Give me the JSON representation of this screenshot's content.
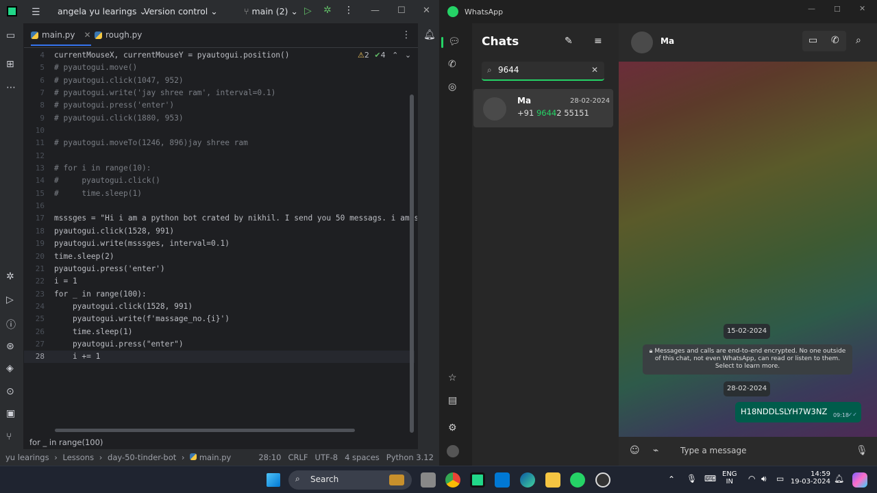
{
  "ide": {
    "project": "angela yu learings",
    "vcs": "Version control",
    "branch": "main (2)",
    "tabs": [
      {
        "label": "main.py"
      },
      {
        "label": "rough.py"
      }
    ],
    "inspections": {
      "warnings": "2",
      "ok": "4"
    },
    "lines": [
      {
        "num": "4",
        "text": "currentMouseX, currentMouseY = pyautogui.position()"
      },
      {
        "num": "5",
        "text": "# pyautogui.move()"
      },
      {
        "num": "6",
        "text": "# pyautogui.click(1047, 952)"
      },
      {
        "num": "7",
        "text": "# pyautogui.write('jay shree ram', interval=0.1)"
      },
      {
        "num": "8",
        "text": "# pyautogui.press('enter')"
      },
      {
        "num": "9",
        "text": "# pyautogui.click(1880, 953)"
      },
      {
        "num": "10",
        "text": ""
      },
      {
        "num": "11",
        "text": "# pyautogui.moveTo(1246, 896)jay shree ram"
      },
      {
        "num": "12",
        "text": ""
      },
      {
        "num": "13",
        "text": "# for i in range(10):"
      },
      {
        "num": "14",
        "text": "#     pyautogui.click()"
      },
      {
        "num": "15",
        "text": "#     time.sleep(1)"
      },
      {
        "num": "16",
        "text": ""
      },
      {
        "num": "17",
        "text": "msssges = \"Hi i am a python bot crated by nikhil. I send you 50 messags. i am s"
      },
      {
        "num": "18",
        "text": "pyautogui.click(1528, 991)"
      },
      {
        "num": "19",
        "text": "pyautogui.write(msssges, interval=0.1)"
      },
      {
        "num": "20",
        "text": "time.sleep(2)"
      },
      {
        "num": "21",
        "text": "pyautogui.press('enter')"
      },
      {
        "num": "22",
        "text": "i = 1"
      },
      {
        "num": "23",
        "text": "for _ in range(100):"
      },
      {
        "num": "24",
        "text": "    pyautogui.click(1528, 991)"
      },
      {
        "num": "25",
        "text": "    pyautogui.write(f'massage_no.{i}')"
      },
      {
        "num": "26",
        "text": "    time.sleep(1)"
      },
      {
        "num": "27",
        "text": "    pyautogui.press(\"enter\")"
      },
      {
        "num": "28",
        "text": "    i += 1"
      }
    ],
    "breadcrumb": "for _ in range(100)",
    "status": {
      "path": [
        "yu learings",
        "Lessons",
        "day-50-tinder-bot",
        "main.py"
      ],
      "position": "28:10",
      "line_sep": "CRLF",
      "encoding": "UTF-8",
      "indent": "4 spaces",
      "interpreter": "Python 3.12"
    }
  },
  "whatsapp": {
    "app_title": "WhatsApp",
    "chats_title": "Chats",
    "search_value": "9644",
    "chat": {
      "name": "Ma",
      "date": "28-02-2024",
      "phone_pre": "+91 ",
      "phone_match": "9644",
      "phone_post": "2 55151"
    },
    "header_name": "Ma",
    "date_pill_1": "15-02-2024",
    "encryption_notice": "Messages and calls are end-to-end encrypted. No one outside of this chat, not even WhatsApp, can read or listen to them. Select to learn more.",
    "date_pill_2": "28-02-2024",
    "message": {
      "text": "H18NDDLSLYH7W3NZ",
      "time": "09:18"
    },
    "input_placeholder": "Type a message"
  },
  "taskbar": {
    "search": "Search",
    "lang": "ENG",
    "region": "IN",
    "time": "14:59",
    "date": "19-03-2024"
  },
  "colors": {
    "accent_green": "#25d366",
    "ide_accent": "#3574f0",
    "bubble": "#005c4b"
  }
}
